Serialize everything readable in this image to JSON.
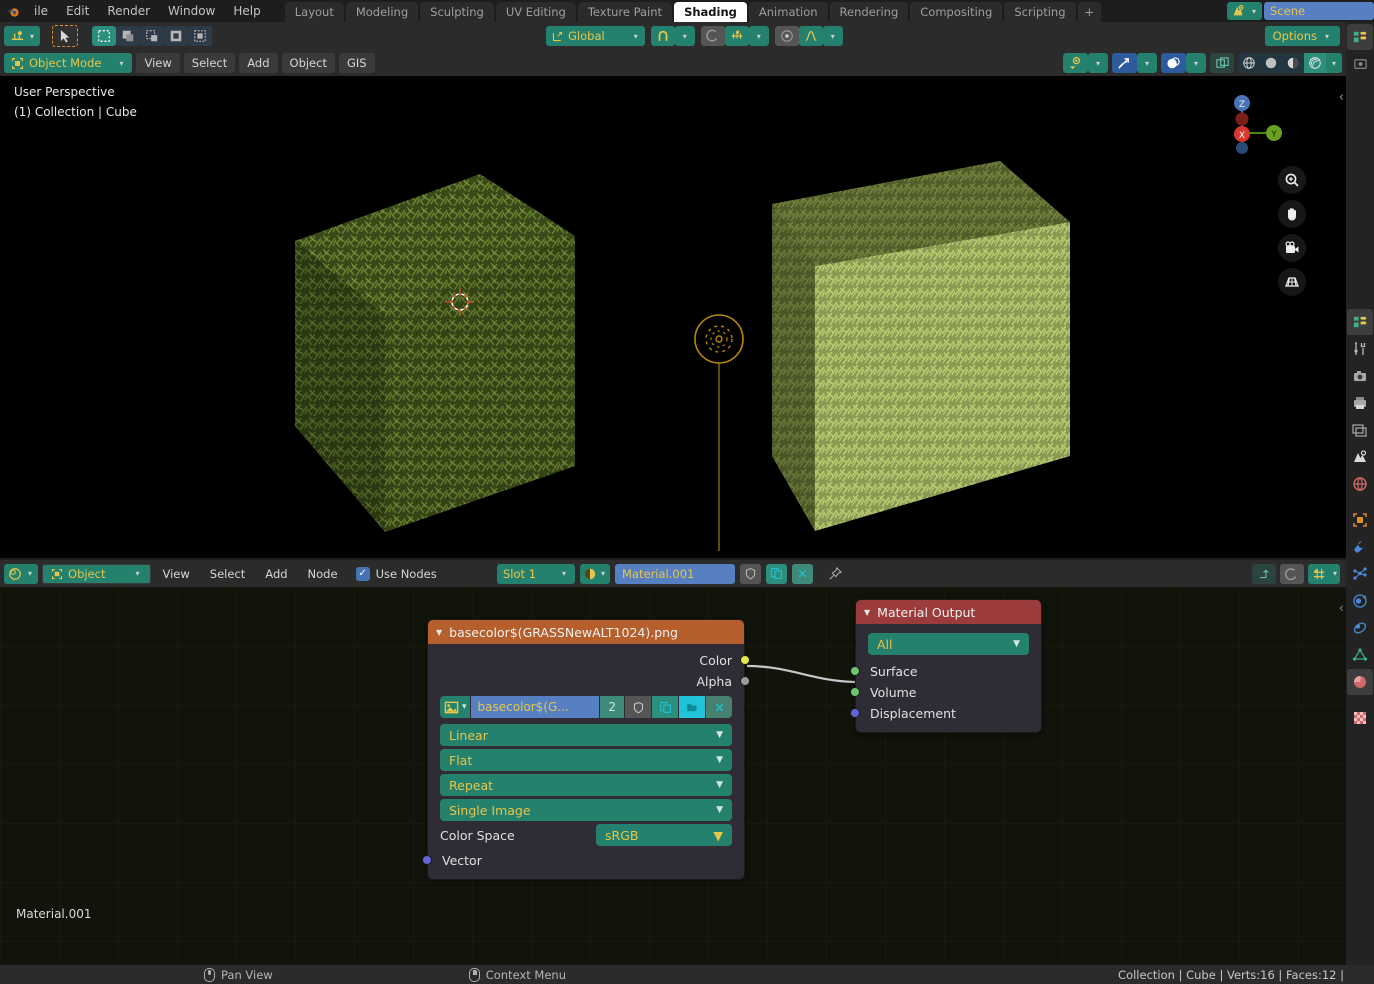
{
  "topbar": {
    "menus": [
      "ile",
      "Edit",
      "Render",
      "Window",
      "Help"
    ],
    "workspace_tabs": [
      {
        "label": "Layout",
        "active": false
      },
      {
        "label": "Modeling",
        "active": false
      },
      {
        "label": "Sculpting",
        "active": false
      },
      {
        "label": "UV Editing",
        "active": false
      },
      {
        "label": "Texture Paint",
        "active": false
      },
      {
        "label": "Shading",
        "active": true
      },
      {
        "label": "Animation",
        "active": false
      },
      {
        "label": "Rendering",
        "active": false
      },
      {
        "label": "Compositing",
        "active": false
      },
      {
        "label": "Scripting",
        "active": false
      },
      {
        "label": "+",
        "active": false
      }
    ],
    "scene_name": "Scene",
    "scene_icon": "scene-icon"
  },
  "tool_header": {
    "editor_type_icon": "editor-type-icon",
    "cursor_tool_icon": "tweak-cursor-icon",
    "select_mode_icons": [
      "select-box-icon",
      "select-extend-icon",
      "select-subtract-icon",
      "select-invert-icon",
      "select-intersect-icon"
    ],
    "transform_orientation": "Global",
    "orientation_icon": "orientation-axis-icon",
    "snap_icon": "magnet-icon",
    "snap_target_icon": "snap-increment-icon",
    "proportional_icon": "proportional-editing-icon",
    "falloff_icon": "smooth-falloff-icon",
    "options_label": "Options"
  },
  "viewport_header": {
    "mode": "Object Mode",
    "mode_icon": "object-mode-icon",
    "menus": [
      "View",
      "Select",
      "Add",
      "Object",
      "GIS"
    ],
    "right_icons": [
      "visibility-icon",
      "gizmo-icon",
      "overlays-icon",
      "xray-icon",
      "shading-wireframe-icon",
      "shading-solid-icon",
      "shading-material-icon",
      "shading-rendered-icon"
    ]
  },
  "viewport": {
    "perspective_label": "User Perspective",
    "collection_label": "(1) Collection | Cube",
    "gizmo_axes": [
      "Z",
      "Y",
      "X"
    ],
    "nav_buttons": [
      "zoom-icon",
      "pan-hand-icon",
      "camera-view-icon",
      "orthographic-toggle-icon"
    ],
    "objects": [
      "cube-left",
      "point-light",
      "cube-right"
    ]
  },
  "node_editor_header": {
    "editor_type_icon": "shader-editor-icon",
    "shader_type": "Object",
    "shader_type_icon": "object-icon",
    "menus": [
      "View",
      "Select",
      "Add",
      "Node"
    ],
    "use_nodes_label": "Use Nodes",
    "use_nodes_checked": true,
    "slot": "Slot 1",
    "material_icon": "material-sphere-icon",
    "material_name": "Material.001",
    "shield_icon": "fake-user-icon",
    "copy_icon": "new-material-icon",
    "unlink_icon": "unlink-icon",
    "pin_icon": "pin-icon",
    "right_icons": [
      "up-arrow-icon",
      "undo-snap-icon",
      "node-snapping-icon"
    ]
  },
  "node_editor": {
    "breadcrumb": "Material.001",
    "nodes": [
      {
        "id": "image-texture",
        "title": "basecolor$(GRASSNewALT1024).png",
        "header_color": "#b45f2c",
        "outputs": [
          {
            "label": "Color",
            "color": "#e5e54c"
          },
          {
            "label": "Alpha",
            "color": "#9a9a9a"
          }
        ],
        "texture_name": "basecolor$(G...",
        "users_count": "2",
        "dropdowns": [
          "Linear",
          "Flat",
          "Repeat",
          "Single Image"
        ],
        "color_space_label": "Color Space",
        "color_space_value": "sRGB",
        "inputs": [
          {
            "label": "Vector",
            "color": "#6363d8"
          }
        ]
      },
      {
        "id": "material-output",
        "title": "Material Output",
        "header_color": "#9c3b3b",
        "target": "All",
        "inputs": [
          {
            "label": "Surface",
            "color": "#6cc56c"
          },
          {
            "label": "Volume",
            "color": "#6cc56c"
          },
          {
            "label": "Displacement",
            "color": "#6363d8"
          }
        ]
      }
    ],
    "links": [
      {
        "from": "image-texture.Color",
        "to": "material-output.Surface"
      }
    ]
  },
  "right_rail": {
    "icons": [
      "tool-properties-icon",
      "render-properties-icon",
      "output-properties-icon",
      "view-layer-properties-icon",
      "scene-properties-icon",
      "world-properties-icon",
      "object-properties-icon",
      "modifier-properties-icon",
      "particle-properties-icon",
      "physics-properties-icon",
      "constraint-properties-icon",
      "data-properties-icon",
      "material-properties-icon",
      "texture-properties-icon"
    ]
  },
  "statusbar": {
    "pan_view": "Pan View",
    "context_menu": "Context Menu",
    "stats": "Collection | Cube | Verts:16 | Faces:12 |"
  }
}
